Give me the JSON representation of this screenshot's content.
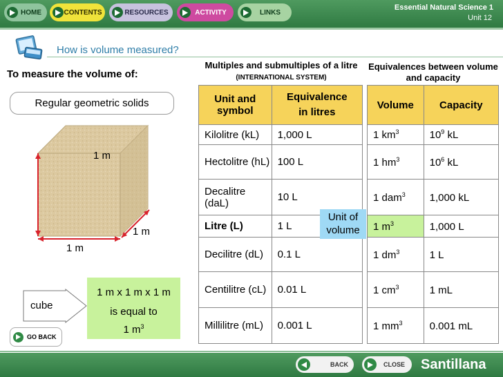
{
  "nav": {
    "home": "HOME",
    "contents": "CONTENTS",
    "resources": "RESOURCES",
    "activity": "ACTIVITY",
    "links": "LINKS"
  },
  "book": {
    "title": "Essential Natural Science 1",
    "unit": "Unit 12"
  },
  "subtitle": "How is volume measured?",
  "left": {
    "heading": "To measure the volume of:",
    "solids": "Regular geometric solids",
    "edge_top": "1 m",
    "edge_right": "1 m",
    "edge_bottom": "1 m",
    "cube": "cube",
    "formula_1": "1 m x 1 m x 1 m",
    "formula_2": "is equal to",
    "formula_3": "1 m",
    "formula_sup": "3",
    "go_back": "GO BACK"
  },
  "table1": {
    "title": "Multiples and submultiples of a litre",
    "title_note": "(INTERNATIONAL SYSTEM)",
    "header_col1": "Unit and symbol",
    "header_col2_a": "Equivalence",
    "header_col2_b": "in litres",
    "rows": [
      {
        "unit": "Kilolitre (kL)",
        "value": "1,000 L"
      },
      {
        "unit": "Hectolitre (hL)",
        "value": "100 L"
      },
      {
        "unit": "Decalitre (daL)",
        "value": "10 L"
      },
      {
        "unit": "Litre (L)",
        "value": "1 L"
      },
      {
        "unit": "Decilitre (dL)",
        "value": "0.1 L"
      },
      {
        "unit": "Centilitre (cL)",
        "value": "0.01 L"
      },
      {
        "unit": "Millilitre (mL)",
        "value": "0.001 L"
      }
    ]
  },
  "unit_badge": "Unit of volume",
  "table2": {
    "title": "Equivalences between volume and capacity",
    "header_volume": "Volume",
    "header_capacity": "Capacity",
    "rows": [
      {
        "volume": "1 km",
        "volume_sup": "3",
        "capacity": "10",
        "capacity_sup": "9",
        "capacity_unit": " kL"
      },
      {
        "volume": "1 hm",
        "volume_sup": "3",
        "capacity": "10",
        "capacity_sup": "6",
        "capacity_unit": " kL"
      },
      {
        "volume": "1 dam",
        "volume_sup": "3",
        "capacity": "1,000 kL",
        "capacity_sup": "",
        "capacity_unit": ""
      },
      {
        "volume": "1 m",
        "volume_sup": "3",
        "capacity": "1,000 L",
        "capacity_sup": "",
        "capacity_unit": ""
      },
      {
        "volume": "1 dm",
        "volume_sup": "3",
        "capacity": "1 L",
        "capacity_sup": "",
        "capacity_unit": ""
      },
      {
        "volume": "1 cm",
        "volume_sup": "3",
        "capacity": "1 mL",
        "capacity_sup": "",
        "capacity_unit": ""
      },
      {
        "volume": "1 mm",
        "volume_sup": "3",
        "capacity": "0.001 mL",
        "capacity_sup": "",
        "capacity_unit": ""
      }
    ]
  },
  "bottom": {
    "back": "BACK",
    "close": "CLOSE",
    "brand": "Santillana"
  },
  "colors": {
    "header_green": "#3f8a52",
    "table_header": "#f6d35a",
    "formula_box": "#c8f29c",
    "highlight_cell": "#c8f29c",
    "unit_badge": "#9fd9f5",
    "subtitle": "#2f7ea8"
  },
  "icons": [
    "play-arrow-icon",
    "computer-icon",
    "cube-illustration"
  ]
}
